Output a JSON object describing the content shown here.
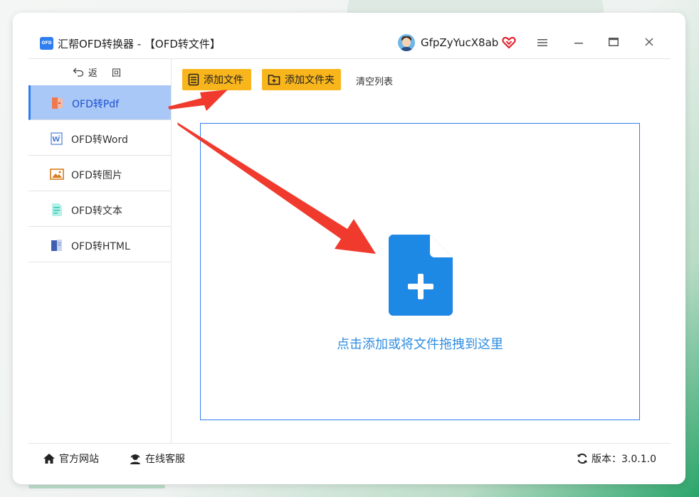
{
  "window": {
    "app_logo_text": "OFD",
    "title": "汇帮OFD转换器 - 【OFD转文件】"
  },
  "user": {
    "name": "GfpZyYucX8ab"
  },
  "sidebar": {
    "back_label": "返 回",
    "items": [
      {
        "label": "OFD转Pdf",
        "icon": "pdf-file-icon",
        "active": true
      },
      {
        "label": "OFD转Word",
        "icon": "word-file-icon",
        "active": false
      },
      {
        "label": "OFD转图片",
        "icon": "image-file-icon",
        "active": false
      },
      {
        "label": "OFD转文本",
        "icon": "text-file-icon",
        "active": false
      },
      {
        "label": "OFD转HTML",
        "icon": "html-file-icon",
        "active": false
      }
    ]
  },
  "toolbar": {
    "add_file_label": "添加文件",
    "add_folder_label": "添加文件夹",
    "clear_list_label": "清空列表"
  },
  "dropzone": {
    "text": "点击添加或将文件拖拽到这里"
  },
  "footer": {
    "website_label": "官方网站",
    "support_label": "在线客服",
    "version_label": "版本：3.0.1.0"
  },
  "colors": {
    "accent": "#2f7ef0",
    "button": "#f8b51c",
    "active_nav": "#a9c8f7",
    "arrow": "#f03a2e",
    "drop_text": "#2f8de0"
  }
}
